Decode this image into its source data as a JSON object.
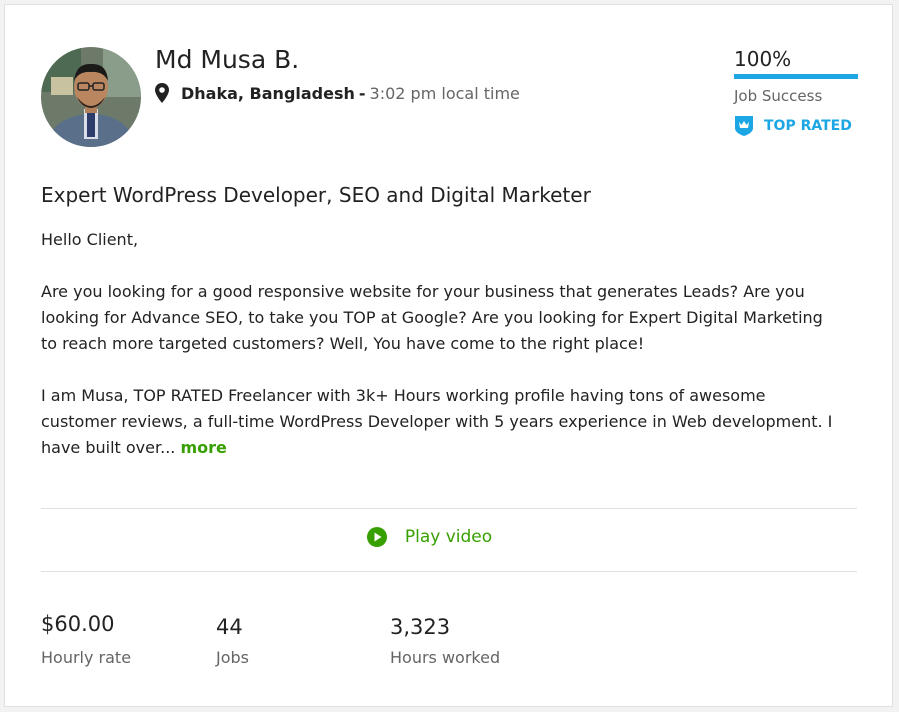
{
  "profile": {
    "name": "Md Musa B.",
    "city": "Dhaka, Bangladesh",
    "separator": "-",
    "local_time": "3:02 pm local time"
  },
  "job_success": {
    "value": "100%",
    "percent": 100,
    "label": "Job Success"
  },
  "badge": {
    "label": "TOP RATED"
  },
  "title": "Expert WordPress Developer, SEO and Digital Marketer",
  "description": {
    "greeting": "Hello Client,",
    "paragraph1": "Are you looking for a good responsive website for your business that generates Leads? Are you looking for Advance SEO, to take you TOP at Google? Are you looking for Expert Digital Marketing to reach more targeted customers? Well, You have come to the right place!",
    "paragraph2": "I am Musa, TOP RATED Freelancer with 3k+ Hours working profile having tons of awesome customer reviews, a full-time WordPress Developer with 5 years experience in Web development. I have built over...",
    "more_label": "more"
  },
  "video": {
    "label": "Play video"
  },
  "stats": [
    {
      "value": "$60.00",
      "label": "Hourly rate"
    },
    {
      "value": "44",
      "label": "Jobs"
    },
    {
      "value": "3,323",
      "label": "Hours worked"
    }
  ],
  "colors": {
    "accent_blue": "#1ca7e4",
    "accent_green": "#37a000",
    "text_muted": "#656565"
  },
  "icons": {
    "location": "map-pin-icon",
    "badge": "crown-shield-icon",
    "video": "play-circle-icon"
  }
}
